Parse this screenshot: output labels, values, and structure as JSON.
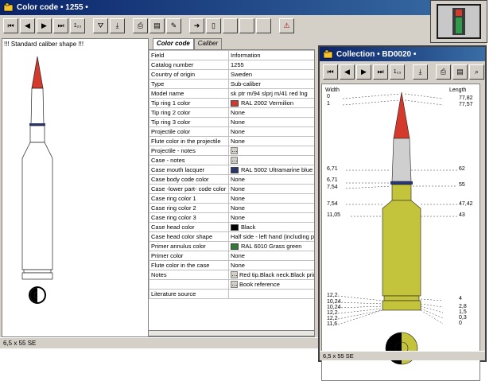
{
  "main": {
    "title": "Color code  •  1255  •",
    "tabs": [
      "Color code",
      "Caliber"
    ],
    "caption": "!!! Standard caliber shape !!!",
    "status": "6,5 x 55 SE",
    "columns": {
      "field": "Field",
      "info": "Information"
    },
    "rows": [
      {
        "field": "Catalog number",
        "info": "1255"
      },
      {
        "field": "Country of origin",
        "info": "Sweden"
      },
      {
        "field": "Type",
        "info": "Sub-caliber"
      },
      {
        "field": "Model name",
        "info": "sk ptr m/94 slprj m/41 red lng"
      },
      {
        "field": "Tip ring 1 color",
        "info": "RAL 2002 Vermilion",
        "swatch": "#d33a2c"
      },
      {
        "field": "Tip ring 2 color",
        "info": "None"
      },
      {
        "field": "Tip ring 3 color",
        "info": "None"
      },
      {
        "field": "Projectile color",
        "info": "None"
      },
      {
        "field": "Flute color in the projectile",
        "info": "None"
      },
      {
        "field": "Projectile - notes",
        "info": "",
        "dots": true
      },
      {
        "field": "Case - notes",
        "info": "",
        "dots": true
      },
      {
        "field": "Case mouth lacquer",
        "info": "RAL 5002 Ultramarine blue",
        "swatch": "#2a3670"
      },
      {
        "field": "Case body code color",
        "info": "None"
      },
      {
        "field": "Case -lower part- code color",
        "info": "None"
      },
      {
        "field": "Case ring color 1",
        "info": "None"
      },
      {
        "field": "Case ring color 2",
        "info": "None"
      },
      {
        "field": "Case ring color 3",
        "info": "None"
      },
      {
        "field": "Case head color",
        "info": "Black",
        "swatch": "#000000"
      },
      {
        "field": "Case head color shape",
        "info": "Half side - left hand (including prim"
      },
      {
        "field": "Primer annulus color",
        "info": "RAL 6010 Grass green",
        "swatch": "#2e7d32"
      },
      {
        "field": "Primer color",
        "info": "None"
      },
      {
        "field": "Flute color in the case",
        "info": "None"
      },
      {
        "field": "Notes",
        "info": "Red tip.Black neck.Black prim",
        "dots": true
      },
      {
        "field": "",
        "info": "Book reference",
        "dots": true
      },
      {
        "field": "Literature source",
        "info": ""
      }
    ]
  },
  "collection": {
    "title": "Collection  •  BD0020  •",
    "status": "6,5 x 55 SE",
    "width_label": "Width",
    "length_label": "Length",
    "left_values": [
      "0",
      "1",
      "6,71",
      "6,71",
      "7,54",
      "7,54",
      "11,05",
      "12,2",
      "10,24",
      "10,24",
      "12,2",
      "12,2",
      "11,6"
    ],
    "right_values": [
      "77,82",
      "77,57",
      "62",
      "55",
      "47,42",
      "43",
      "4",
      "2,8",
      "1,5",
      "0,3",
      "0"
    ]
  },
  "colors": {
    "title_bar_start": "#0a246a",
    "title_bar_end": "#3a6ea5",
    "tip_red": "#d33a2c",
    "case_yellow": "#c3c33c",
    "mouth_blue": "#2a3670"
  }
}
